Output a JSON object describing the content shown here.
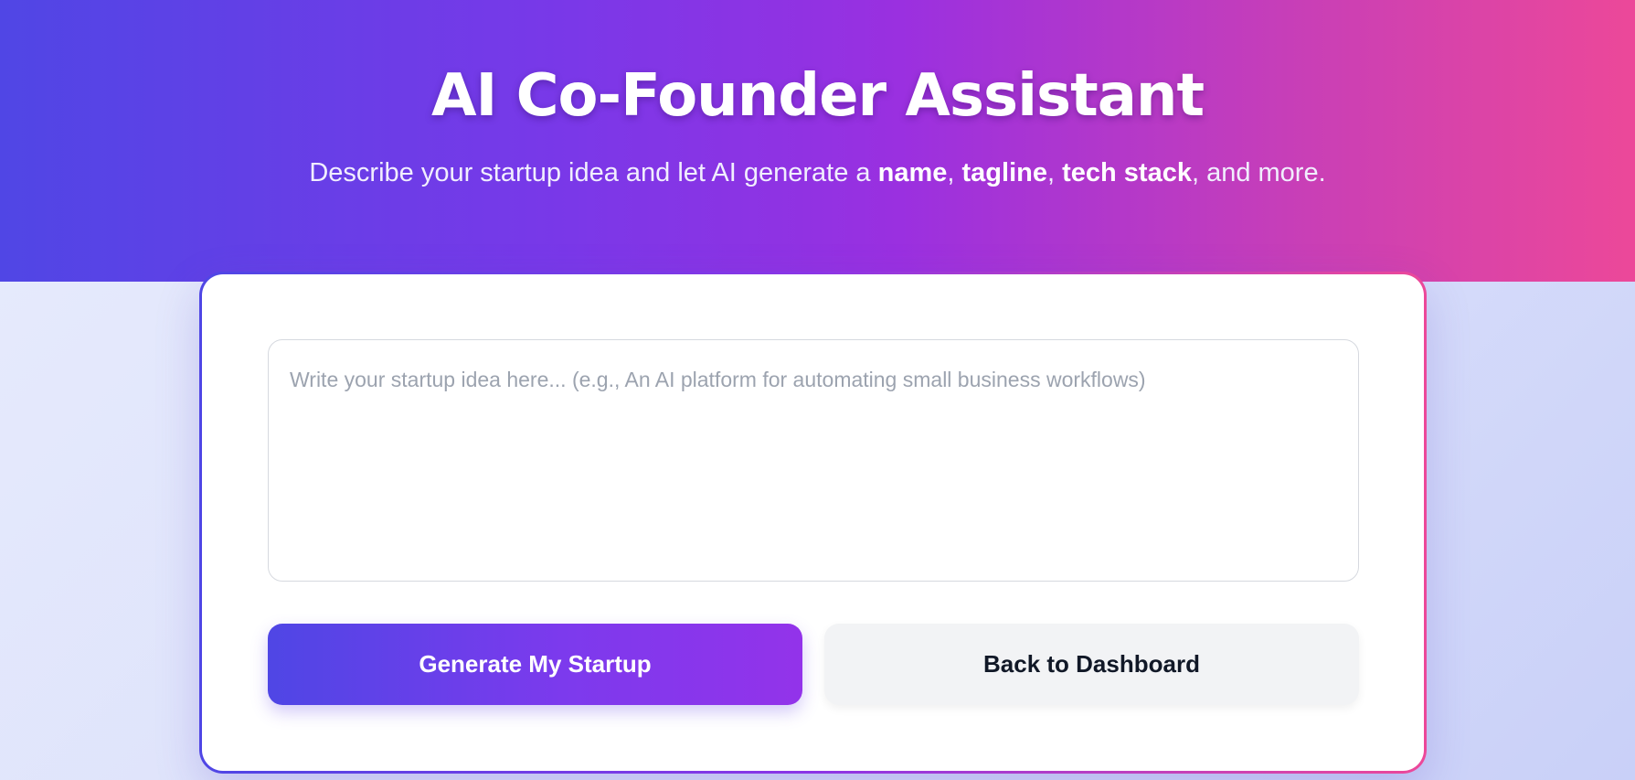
{
  "colors": {
    "gradient_start": "#4f46e5",
    "gradient_mid": "#9333ea",
    "gradient_end": "#ec4899",
    "secondary_button_bg": "#f2f3f5"
  },
  "hero": {
    "title": "AI Co-Founder Assistant",
    "subtitle": {
      "prefix": "Describe your startup idea and let AI generate a ",
      "bold_1": "name",
      "sep_1": ", ",
      "bold_2": "tagline",
      "sep_2": ", ",
      "bold_3": "tech stack",
      "suffix": ", and more."
    }
  },
  "form": {
    "idea_input": {
      "value": "",
      "placeholder": "Write your startup idea here... (e.g., An AI platform for automating small business workflows)"
    },
    "generate_button_label": "Generate My Startup",
    "back_button_label": "Back to Dashboard"
  }
}
